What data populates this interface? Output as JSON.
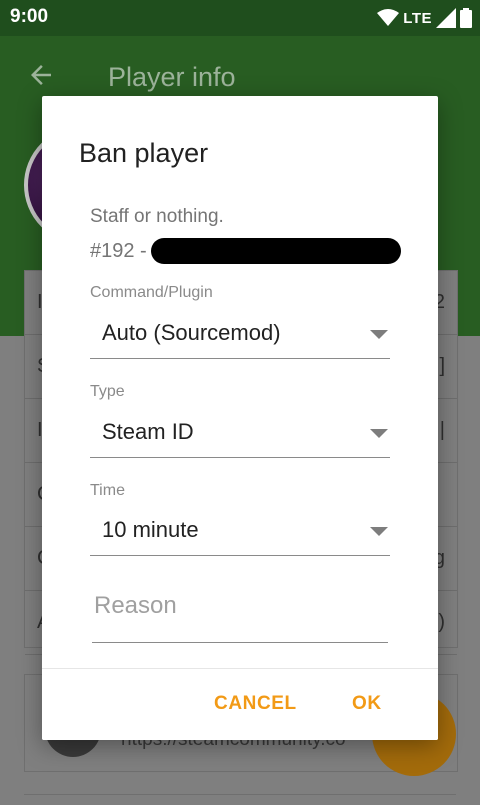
{
  "status_bar": {
    "time": "9:00",
    "network": "LTE"
  },
  "app_bar": {
    "title": "Player info"
  },
  "background_card": {
    "rows": [
      {
        "left": "I",
        "right": "2"
      },
      {
        "left": "S",
        "right": "]"
      },
      {
        "left": "I",
        "right": "|"
      },
      {
        "left": "C",
        "right": ""
      },
      {
        "left": "C",
        "right": "g"
      },
      {
        "left": "A",
        "right": ")"
      }
    ]
  },
  "link_card": {
    "url": "https://steamcommunity.co"
  },
  "dialog": {
    "title": "Ban player",
    "staff_text": "Staff or nothing.",
    "player_id_prefix": "#192 -",
    "fields": {
      "command": {
        "label": "Command/Plugin",
        "value": "Auto (Sourcemod)"
      },
      "type": {
        "label": "Type",
        "value": "Steam ID"
      },
      "time": {
        "label": "Time",
        "value": "10 minute"
      }
    },
    "reason": {
      "placeholder": "Reason",
      "value": ""
    },
    "buttons": {
      "cancel": "CANCEL",
      "ok": "OK"
    }
  },
  "colors": {
    "accent": "#f29a16",
    "app_bar": "#285d22",
    "status_bar": "#1f4e1d"
  }
}
